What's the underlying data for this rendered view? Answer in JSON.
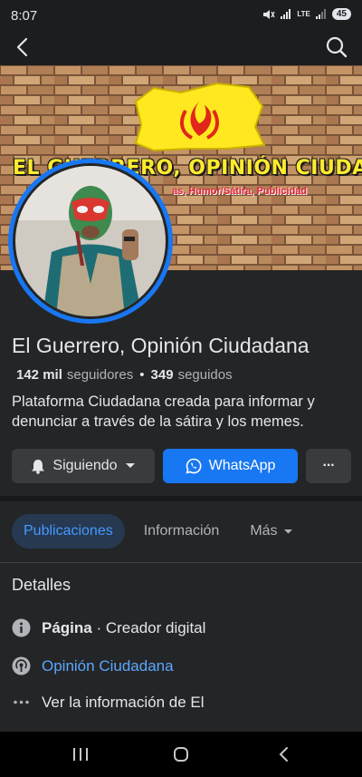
{
  "status_bar": {
    "time": "8:07",
    "network_label": "LTE",
    "battery": "45"
  },
  "icons": {
    "back": "back-arrow-icon",
    "search": "search-icon",
    "bell": "bell-icon",
    "caret": "caret-down-icon",
    "whatsapp": "whatsapp-icon",
    "more": "more-horizontal-icon",
    "info": "info-icon",
    "podcast": "podcast-icon",
    "dots": "dots-icon"
  },
  "cover": {
    "title": "EL GUERRERO, OPINIÓN CIUDADANA",
    "subtitle": "as, Humor/Sátira, Publicidad"
  },
  "profile": {
    "name": "El Guerrero, Opinión Ciudadana",
    "followers_count": "142 mil",
    "followers_label": "seguidores",
    "separator": "•",
    "following_count": "349",
    "following_label": "seguidos",
    "bio": "Plataforma Ciudadana creada para informar y denunciar a través de la sátira y los memes."
  },
  "actions": {
    "follow_label": "Siguiendo",
    "whatsapp_label": "WhatsApp",
    "more_label": "···"
  },
  "tabs": [
    {
      "label": "Publicaciones",
      "active": true
    },
    {
      "label": "Información",
      "active": false
    },
    {
      "label": "Más",
      "active": false
    }
  ],
  "details": {
    "title": "Detalles",
    "page_type_bold": "Página",
    "page_type_rest": " · Creador digital",
    "link_label": "Opinión Ciudadana",
    "see_more": "Ver la información de El"
  },
  "colors": {
    "accent": "#1877f2",
    "background": "#242526",
    "tab_active_text": "#4599ff",
    "link": "#5aa7ff"
  }
}
